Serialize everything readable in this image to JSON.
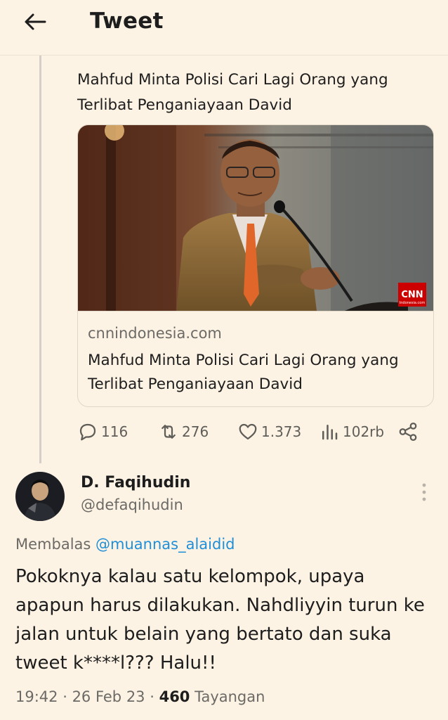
{
  "header": {
    "title": "Tweet",
    "back_icon": "arrow-left-icon"
  },
  "quoted": {
    "text": "Mahfud Minta Polisi Cari Lagi Orang yang Terlibat Penganiayaan David"
  },
  "link_card": {
    "image_logo": "CNN",
    "image_logo_sub": "Indonesia.com",
    "domain": "cnnindonesia.com",
    "title": "Mahfud Minta Polisi Cari Lagi Orang yang Terlibat Penganiayaan David"
  },
  "actions": {
    "replies": "116",
    "retweets": "276",
    "likes": "1.373",
    "views": "102rb"
  },
  "reply": {
    "display_name": "D. Faqihudin",
    "handle": "@defaqihudin",
    "replying_label": "Membalas",
    "replying_to": "@muannas_alaidid",
    "text": "Pokoknya kalau satu kelompok, upaya apapun harus dilakukan. Nahdliyyin turun ke jalan untuk belain yang bertato dan suka tweet k****l??? Halu!!",
    "time": "19:42",
    "date": "26 Feb 23",
    "views_count": "460",
    "views_label": "Tayangan"
  },
  "colors": {
    "background": "#fdf3e4",
    "link": "#1f8fd8",
    "muted": "#6c6a66"
  }
}
